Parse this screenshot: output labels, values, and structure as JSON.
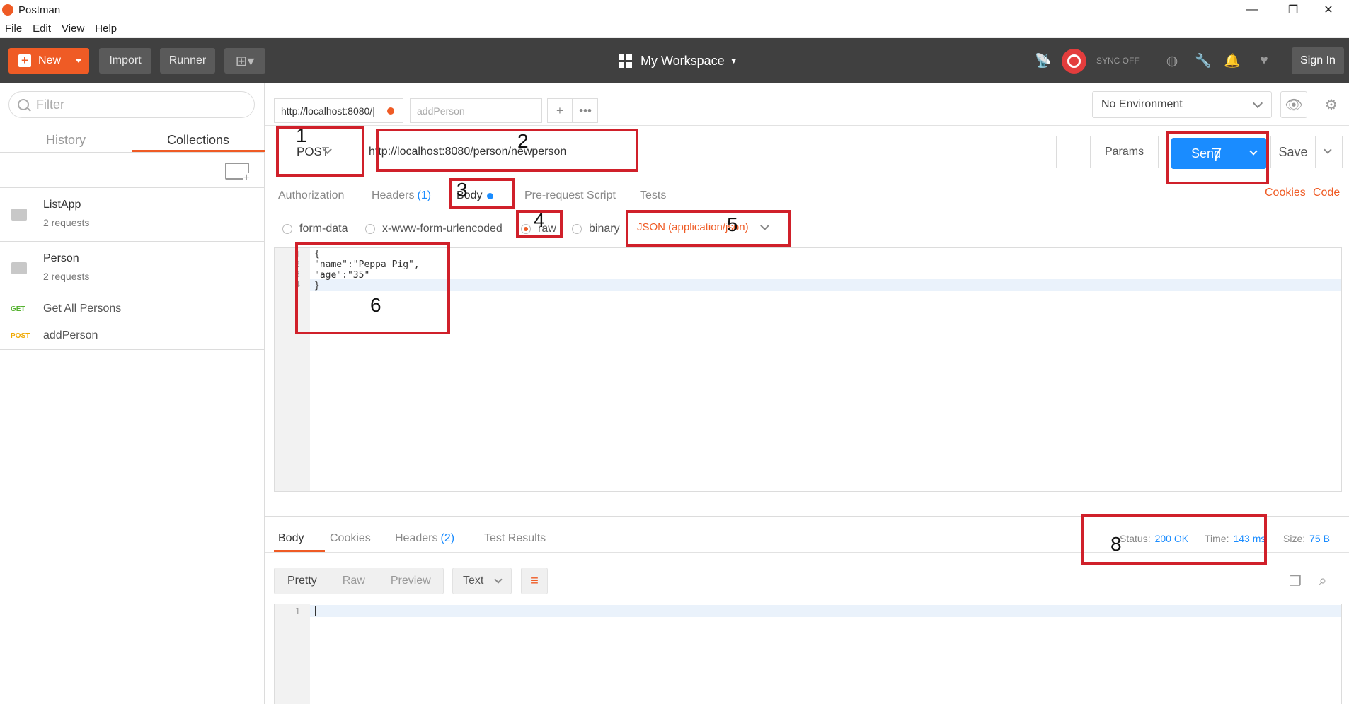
{
  "window": {
    "title": "Postman",
    "min": "—",
    "max": "❐",
    "close": "✕"
  },
  "menu": [
    "File",
    "Edit",
    "View",
    "Help"
  ],
  "header": {
    "new_label": "New",
    "import_label": "Import",
    "runner_label": "Runner",
    "workspace_label": "My Workspace",
    "sync_label": "SYNC OFF",
    "signin_label": "Sign In"
  },
  "sidebar": {
    "filter_placeholder": "Filter",
    "tabs": [
      "History",
      "Collections"
    ],
    "active_tab": "Collections",
    "collections": [
      {
        "name": "ListApp",
        "count": "2 requests"
      },
      {
        "name": "Person",
        "count": "2 requests"
      }
    ],
    "requests": [
      {
        "method": "GET",
        "name": "Get All Persons",
        "color": "#55b230"
      },
      {
        "method": "POST",
        "name": "addPerson",
        "color": "#f0a800"
      }
    ]
  },
  "tabs": [
    {
      "label": "http://localhost:8080/|",
      "unsaved": true
    },
    {
      "label": "addPerson",
      "unsaved": false
    }
  ],
  "environment": {
    "selected": "No Environment"
  },
  "request": {
    "method": "POST",
    "url": "http://localhost:8080/person/newperson",
    "params_label": "Params",
    "send_label": "Send",
    "save_label": "Save",
    "tabs": {
      "authorization": "Authorization",
      "headers": "Headers",
      "headers_count": "(1)",
      "body": "Body",
      "prerequest": "Pre-request Script",
      "tests": "Tests"
    },
    "cookies_link": "Cookies",
    "code_link": "Code",
    "body_modes": [
      "form-data",
      "x-www-form-urlencoded",
      "raw",
      "binary"
    ],
    "selected_mode": "raw",
    "content_type": "JSON (application/json)",
    "body_lines": [
      "{",
      "\"name\":\"Peppa Pig\",",
      "\"age\":\"35\"",
      "}"
    ]
  },
  "response": {
    "tabs": {
      "body": "Body",
      "cookies": "Cookies",
      "headers": "Headers",
      "headers_count": "(2)",
      "test_results": "Test Results"
    },
    "status_label": "Status:",
    "status_value": "200 OK",
    "time_label": "Time:",
    "time_value": "143 ms",
    "size_label": "Size:",
    "size_value": "75 B",
    "formats": [
      "Pretty",
      "Raw",
      "Preview"
    ],
    "active_format": "Pretty",
    "format_type": "Text",
    "line_numbers": [
      "1"
    ]
  },
  "annotations": [
    "1",
    "2",
    "3",
    "4",
    "5",
    "6",
    "7",
    "8"
  ],
  "colors": {
    "accent": "#ef5b25",
    "send_blue": "#1a8cff",
    "annotation_red": "#d0202a",
    "header_bg": "#404040"
  }
}
